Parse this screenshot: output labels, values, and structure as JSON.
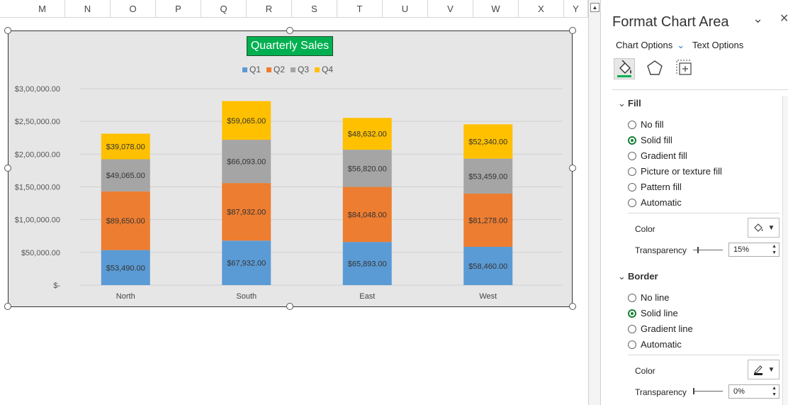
{
  "columns": [
    "M",
    "N",
    "O",
    "P",
    "Q",
    "R",
    "S",
    "T",
    "U",
    "V",
    "W",
    "X",
    "Y"
  ],
  "chart_data": {
    "type": "bar",
    "stacked": true,
    "title": "Quarterly Sales",
    "categories": [
      "North",
      "South",
      "East",
      "West"
    ],
    "series": [
      {
        "name": "Q1",
        "color": "#5b9bd5",
        "values": [
          53490,
          67932,
          65893,
          58460
        ],
        "labels": [
          "$53,490.00",
          "$67,932.00",
          "$65,893.00",
          "$58,460.00"
        ]
      },
      {
        "name": "Q2",
        "color": "#ed7d31",
        "values": [
          89650,
          87932,
          84048,
          81278
        ],
        "labels": [
          "$89,650.00",
          "$87,932.00",
          "$84,048.00",
          "$81,278.00"
        ]
      },
      {
        "name": "Q3",
        "color": "#a5a5a5",
        "values": [
          49065,
          66093,
          56820,
          53459
        ],
        "labels": [
          "$49,065.00",
          "$66,093.00",
          "$56,820.00",
          "$53,459.00"
        ]
      },
      {
        "name": "Q4",
        "color": "#ffc000",
        "values": [
          39078,
          59065,
          48632,
          52340
        ],
        "labels": [
          "$39,078.00",
          "$59,065.00",
          "$48,632.00",
          "$52,340.00"
        ]
      }
    ],
    "ylim": [
      0,
      300000
    ],
    "yticks": [
      0,
      50000,
      100000,
      150000,
      200000,
      250000,
      300000
    ],
    "ytick_labels": [
      "$-",
      "$50,000.00",
      "$1,00,000.00",
      "$1,50,000.00",
      "$2,00,000.00",
      "$2,50,000.00",
      "$3,00,000.00"
    ],
    "legend_position": "top",
    "grid": true,
    "background": "#e6e6e6",
    "title_background": "#00b050"
  },
  "pane": {
    "title": "Format Chart Area",
    "chart_options_label": "Chart Options",
    "text_options_label": "Text Options",
    "fill": {
      "header": "Fill",
      "options": [
        "No fill",
        "Solid fill",
        "Gradient fill",
        "Picture or texture fill",
        "Pattern fill",
        "Automatic"
      ],
      "selected": "Solid fill",
      "color_label": "Color",
      "transparency_label": "Transparency",
      "transparency_value": "15%",
      "transparency_fraction": 0.15
    },
    "border": {
      "header": "Border",
      "options": [
        "No line",
        "Solid line",
        "Gradient line",
        "Automatic"
      ],
      "selected": "Solid line",
      "color_label": "Color",
      "transparency_label": "Transparency",
      "transparency_value": "0%",
      "transparency_fraction": 0
    }
  }
}
